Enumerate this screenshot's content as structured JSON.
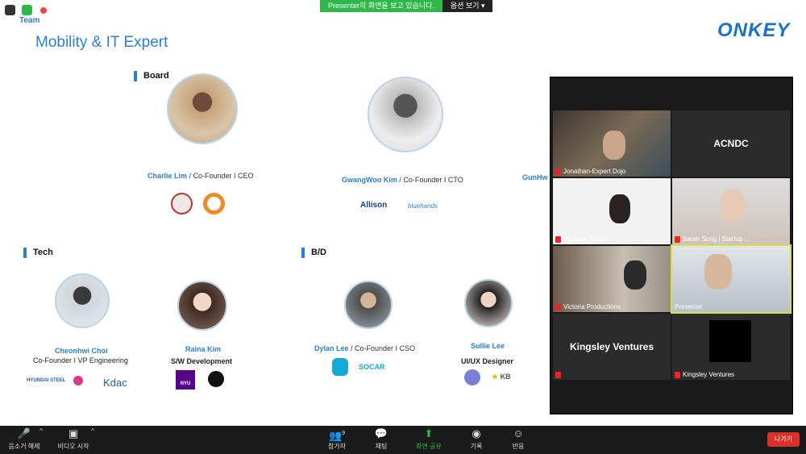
{
  "share_banner": {
    "text": "Presenter의 화면을 보고 있습니다.",
    "options": "옵션 보기"
  },
  "slide": {
    "team_label": "Team",
    "title": "Mobility & IT Expert",
    "logo": "ONKEY",
    "sections": {
      "board": "Board",
      "tech": "Tech",
      "bd": "B/D"
    },
    "people": [
      {
        "name": "Charlie Lim",
        "role": " / Co-Founder I CEO"
      },
      {
        "name": "GwangWoo Kim",
        "role": " / Co-Founder I CTO"
      },
      {
        "name": "GunHw",
        "role": ""
      },
      {
        "name": "Cheonhwi Choi",
        "role": "Co-Founder I VP Engineering"
      },
      {
        "name": "Raina Kim",
        "role": "S/W Development"
      },
      {
        "name": "Dylan Lee",
        "role": " / Co-Founder I CSO"
      },
      {
        "name": "Sullie Lee",
        "role": "UI/UX Designer"
      }
    ],
    "logos": {
      "allison": "Allison",
      "bluehands": "bluehands",
      "hyundai": "HYUNDAI STEEL",
      "kdac": "Kdac",
      "nyu": "NYU",
      "socar": "SOCAR",
      "kb": "KB"
    }
  },
  "gallery": {
    "tiles": [
      {
        "name": "Jonathan-Expert Dojo",
        "big": ""
      },
      {
        "name": "",
        "big": "ACNDC"
      },
      {
        "name": "Michelle Irawan",
        "big": ""
      },
      {
        "name": "Sarah Song | Startup ...",
        "big": ""
      },
      {
        "name": "Victoria Productions",
        "big": ""
      },
      {
        "name": "Presenter",
        "big": ""
      },
      {
        "name": "",
        "big": "Kingsley Ventures"
      },
      {
        "name": "Kingsley Ventures",
        "big": ""
      }
    ]
  },
  "toolbar": {
    "mute": "음소거 해제",
    "video": "비디오 시작",
    "participants": "참가자",
    "participants_count": "9",
    "chat": "채팅",
    "share": "화면 공유",
    "record": "기록",
    "reactions": "반응",
    "leave": "나가기"
  }
}
